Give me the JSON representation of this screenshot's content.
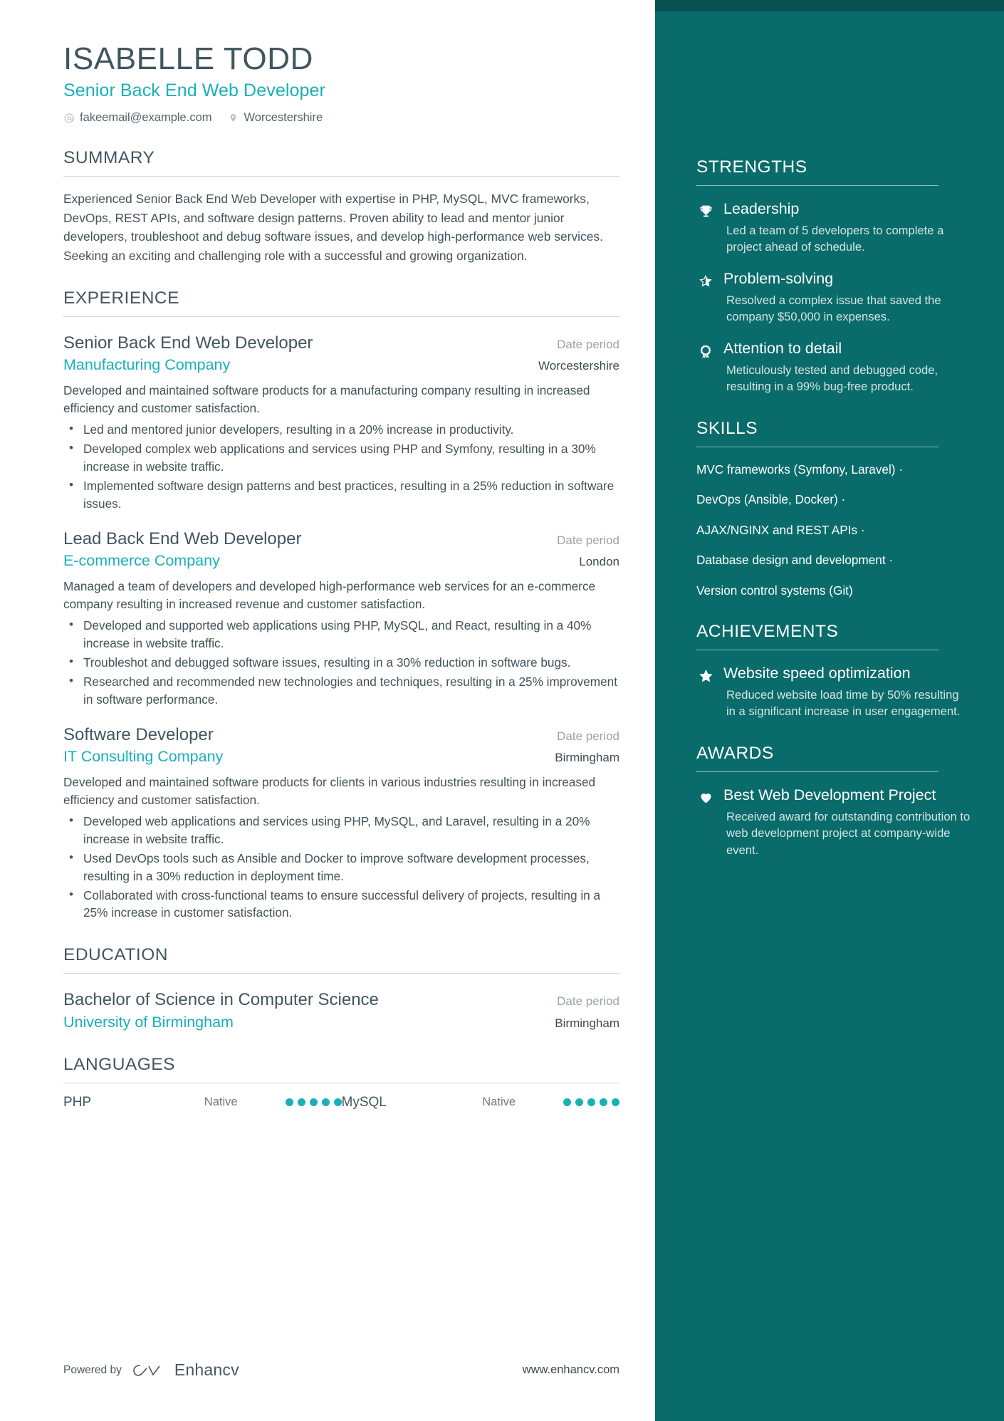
{
  "theme": {
    "accent_teal": "#19b0b8",
    "sidebar_bg": "#0a6b6b",
    "sidebar_top_strip": "#06504f",
    "heading_color": "#41565f"
  },
  "header": {
    "name": "ISABELLE TODD",
    "job_title": "Senior Back End Web Developer",
    "contacts": [
      {
        "icon": "at-sign-icon",
        "glyph": "@",
        "text": "fakeemail@example.com"
      },
      {
        "icon": "location-pin-icon",
        "glyph": "pin",
        "text": "Worcestershire"
      }
    ]
  },
  "summary": {
    "heading": "SUMMARY",
    "text": "Experienced Senior Back End Web Developer with expertise in PHP, MySQL, MVC frameworks, DevOps, REST APIs, and software design patterns. Proven ability to lead and mentor junior developers, troubleshoot and debug software issues, and develop high-performance web services. Seeking an exciting and challenging role with a successful and growing organization."
  },
  "experience": {
    "heading": "EXPERIENCE",
    "entries": [
      {
        "title": "Senior Back End Web Developer",
        "date": "Date period",
        "organization": "Manufacturing Company",
        "location": "Worcestershire",
        "description": "Developed and maintained software products for a manufacturing company resulting in increased efficiency and customer satisfaction.",
        "bullets": [
          "Led and mentored junior developers, resulting in a 20% increase in productivity.",
          "Developed complex web applications and services using PHP and Symfony, resulting in a 30% increase in website traffic.",
          "Implemented software design patterns and best practices, resulting in a 25% reduction in software issues."
        ]
      },
      {
        "title": "Lead Back End Web Developer",
        "date": "Date period",
        "organization": "E-commerce Company",
        "location": "London",
        "description": "Managed a team of developers and developed high-performance web services for an e-commerce company resulting in increased revenue and customer satisfaction.",
        "bullets": [
          "Developed and supported web applications using PHP, MySQL, and React, resulting in a 40% increase in website traffic.",
          "Troubleshot and debugged software issues, resulting in a 30% reduction in software bugs.",
          "Researched and recommended new technologies and techniques, resulting in a 25% improvement in software performance."
        ]
      },
      {
        "title": "Software Developer",
        "date": "Date period",
        "organization": "IT Consulting Company",
        "location": "Birmingham",
        "description": "Developed and maintained software products for clients in various industries resulting in increased efficiency and customer satisfaction.",
        "bullets": [
          "Developed web applications and services using PHP, MySQL, and Laravel, resulting in a 20% increase in website traffic.",
          "Used DevOps tools such as Ansible and Docker to improve software development processes, resulting in a 30% reduction in deployment time.",
          "Collaborated with cross-functional teams to ensure successful delivery of projects, resulting in a 25% increase in customer satisfaction."
        ]
      }
    ]
  },
  "education": {
    "heading": "EDUCATION",
    "entries": [
      {
        "title": "Bachelor of Science in Computer Science",
        "date": "Date period",
        "organization": "University of Birmingham",
        "location": "Birmingham"
      }
    ]
  },
  "languages": {
    "heading": "LANGUAGES",
    "items": [
      {
        "name": "PHP",
        "level": "Native",
        "dots_filled": 5,
        "dots_total": 5
      },
      {
        "name": "MySQL",
        "level": "Native",
        "dots_filled": 5,
        "dots_total": 5
      }
    ]
  },
  "footer": {
    "powered_by_label": "Powered by",
    "brand": "Enhancv",
    "brand_logo_icon": "enhancv-logo-icon",
    "site_url": "www.enhancv.com"
  },
  "sidebar": {
    "strengths": {
      "heading": "STRENGTHS",
      "items": [
        {
          "icon": "trophy-icon",
          "title": "Leadership",
          "desc": "Led a team of 5 developers to complete a project ahead of schedule."
        },
        {
          "icon": "star-outline-icon",
          "title": "Problem-solving",
          "desc": "Resolved a complex issue that saved the company $50,000 in expenses."
        },
        {
          "icon": "award-medal-icon",
          "title": "Attention to detail",
          "desc": "Meticulously tested and debugged code, resulting in a 99% bug-free product."
        }
      ]
    },
    "skills": {
      "heading": "SKILLS",
      "items": [
        "MVC frameworks (Symfony, Laravel) ·",
        "DevOps (Ansible, Docker) ·",
        "AJAX/NGINX and REST APIs ·",
        "Database design and development ·",
        "Version control systems (Git)"
      ]
    },
    "achievements": {
      "heading": "ACHIEVEMENTS",
      "items": [
        {
          "icon": "star-filled-icon",
          "title": "Website speed optimization",
          "desc": "Reduced website load time by 50% resulting in a significant increase in user engagement."
        }
      ]
    },
    "awards": {
      "heading": "AWARDS",
      "items": [
        {
          "icon": "heart-icon",
          "title": "Best Web Development Project",
          "desc": "Received award for outstanding contribution to web development project at company-wide event."
        }
      ]
    }
  }
}
